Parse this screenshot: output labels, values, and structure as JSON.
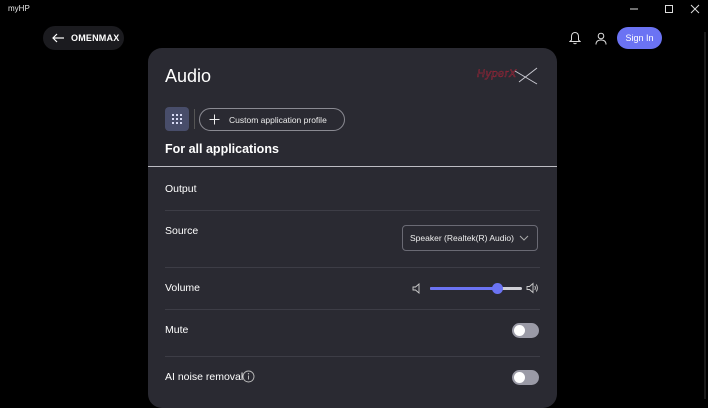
{
  "window": {
    "title": "myHP"
  },
  "header": {
    "back_label": "OMENMAX",
    "signin_label": "Sign In"
  },
  "card": {
    "title": "Audio",
    "brand": "HyperX",
    "profile_button_label": "Custom application profile",
    "scope_heading": "For all applications",
    "output_label": "Output",
    "source": {
      "label": "Source",
      "selected": "Speaker (Realtek(R) Audio)"
    },
    "volume": {
      "label": "Volume",
      "level_percent": 73
    },
    "mute": {
      "label": "Mute",
      "on": false
    },
    "noise_removal": {
      "label": "AI noise removal",
      "on": false
    }
  },
  "colors": {
    "accent": "#6b73f3",
    "background": "#000000",
    "card": "#2a2a32",
    "brand_red": "#e0203a"
  },
  "icons": [
    "arrow-left-icon",
    "bell-icon",
    "user-icon",
    "grid-icon",
    "plus-icon",
    "chevron-down-icon",
    "speaker-low-icon",
    "speaker-high-icon",
    "info-icon",
    "minimize-icon",
    "maximize-icon",
    "close-icon"
  ]
}
